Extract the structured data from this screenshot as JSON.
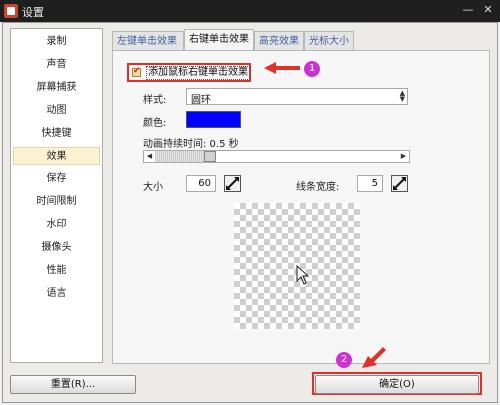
{
  "window": {
    "title": "设置"
  },
  "sidebar": {
    "items": [
      {
        "label": "录制"
      },
      {
        "label": "声音"
      },
      {
        "label": "屏幕捕获"
      },
      {
        "label": "动图"
      },
      {
        "label": "快捷键"
      },
      {
        "label": "效果",
        "active": true
      },
      {
        "label": "保存"
      },
      {
        "label": "时间限制"
      },
      {
        "label": "水印"
      },
      {
        "label": "摄像头"
      },
      {
        "label": "性能"
      },
      {
        "label": "语言"
      }
    ]
  },
  "tabs": [
    {
      "label": "左键单击效果"
    },
    {
      "label": "右键单击效果",
      "active": true
    },
    {
      "label": "高亮效果"
    },
    {
      "label": "光标大小"
    }
  ],
  "effect": {
    "enable_label": "添加鼠标右键单击效果",
    "enabled": true,
    "style_label": "样式:",
    "style_value": "圆环",
    "color_label": "颜色:",
    "color_value": "#0000ff",
    "duration_label": "动画持续时间: 0.5 秒",
    "duration_seconds": 0.5,
    "duration_slider_fraction": 0.2,
    "size_label": "大小",
    "size_value": "60",
    "line_width_label": "线条宽度:",
    "line_width_value": "5"
  },
  "annotations": {
    "step1": "1",
    "step2": "2"
  },
  "buttons": {
    "reset": "重置(R)...",
    "ok": "确定(O)"
  },
  "icons": {
    "window_icon": "app-icon",
    "spin_button": "slash-arrow-icon",
    "cursor": "mouse-pointer-icon",
    "step_arrow": "red-arrow-icon"
  },
  "colors": {
    "highlight": "#e0302a",
    "badge": "#cc33cc",
    "active_item": "#fbf3d4"
  }
}
